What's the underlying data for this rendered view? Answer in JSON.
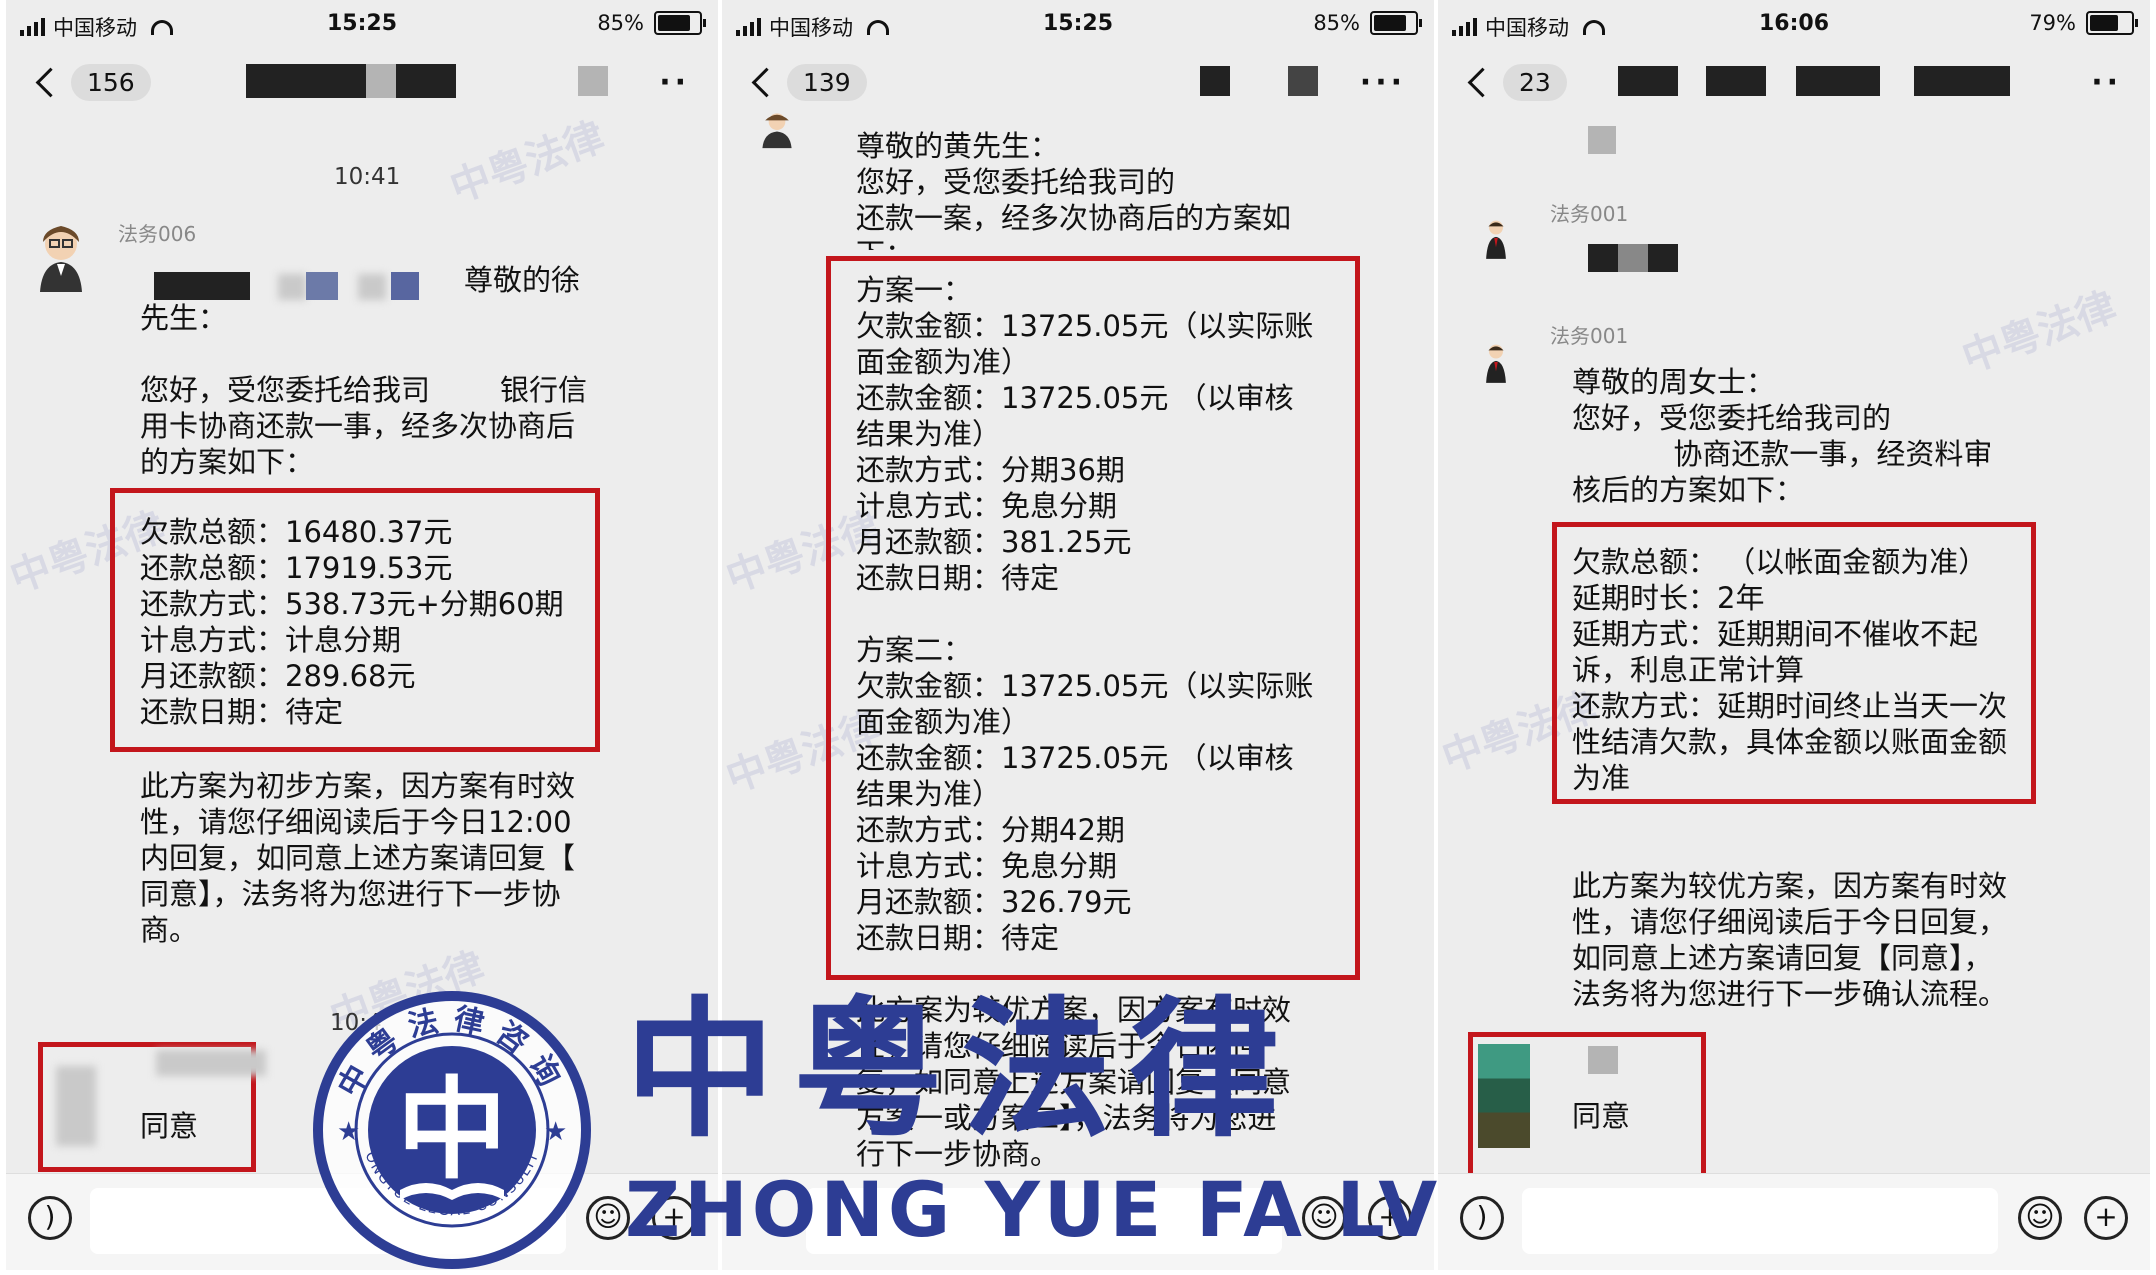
{
  "panels": [
    {
      "status": {
        "carrier": "中国移动",
        "time": "15:25",
        "battery": "85%"
      },
      "back_count": "156",
      "chat_time_1": "10:41",
      "sender": "法务006",
      "greeting_tail": "尊敬的徐",
      "lines_top": [
        "先生：",
        "",
        "您好，受您委托给我司",
        "用卡协商还款一事，经多次协商后",
        "的方案如下："
      ],
      "bank_fragment": "银行信",
      "box_lines": [
        "欠款总额：16480.37元",
        "还款总额：17919.53元",
        "还款方式：538.73元+分期60期",
        "计息方式：计息分期",
        "月还款额：289.68元",
        "还款日期：待定"
      ],
      "lines_bottom": [
        "此方案为初步方案，因方案有时效",
        "性，请您仔细阅读后于今日12:00",
        "内回复，如同意上述方案请回复【",
        "同意】，法务将为您进行下一步协",
        "商。"
      ],
      "chat_time_2": "10:4",
      "reply": "同意"
    },
    {
      "status": {
        "carrier": "中国移动",
        "time": "15:25",
        "battery": "85%"
      },
      "back_count": "139",
      "lines_top": [
        "尊敬的黄先生：",
        "您好，受您委托给我司的",
        "还款一案，经多次协商后的方案如",
        "下："
      ],
      "box_lines": [
        "方案一：",
        "欠款金额：13725.05元（以实际账",
        "面金额为准）",
        "还款金额：13725.05元 （以审核",
        "结果为准）",
        "还款方式：分期36期",
        "计息方式：免息分期",
        "月还款额：381.25元",
        "还款日期：待定",
        "",
        "方案二：",
        "欠款金额：13725.05元（以实际账",
        "面金额为准）",
        "还款金额：13725.05元 （以审核",
        "结果为准）",
        "还款方式：分期42期",
        "计息方式：免息分期",
        "月还款额：326.79元",
        "还款日期：待定"
      ],
      "lines_bottom": [
        "此方案为较优方案，因方案有时效",
        "性，请您仔细阅读后于今日内回",
        "复，如同意上述方案请回复【同意",
        "方案一或方案二】，法务将为您进",
        "行下一步协商。"
      ]
    },
    {
      "status": {
        "carrier": "中国移动",
        "time": "16:06",
        "battery": "79%"
      },
      "back_count": "23",
      "sender_1": "法务001",
      "sender_2": "法务001",
      "lines_top": [
        "尊敬的周女士：",
        "您好，受您委托给我司的",
        "           协商还款一事，经资料审",
        "核后的方案如下："
      ],
      "box_lines": [
        "欠款总额： （以帐面金额为准）",
        "延期时长：2年",
        "延期方式：延期期间不催收不起",
        "诉，利息正常计算",
        "还款方式：延期时间终止当天一次",
        "性结清欠款，具体金额以账面金额",
        "为准"
      ],
      "lines_bottom": [
        "此方案为较优方案，因方案有时效",
        "性，请您仔细阅读后于今日回复，",
        "如同意上述方案请回复【同意】，",
        "法务将为您进行下一步确认流程。"
      ],
      "reply": "同意"
    }
  ],
  "watermark": {
    "seal_top": "中粤法律咨询",
    "seal_bottom": "ZHONGYUE LEGAL CONSULTING",
    "seal_center": "中",
    "title": "中粤法律",
    "subtitle": "ZHONG YUE FA LV",
    "bg_text": "中粤法律"
  },
  "colors": {
    "accent_red": "#c3161c",
    "logo_blue": "#2d3d94",
    "chat_bg": "#ededed"
  },
  "icons": [
    "signal-icon",
    "wifi-icon",
    "battery-icon",
    "back-arrow-icon",
    "more-icon",
    "voice-icon",
    "emoji-icon",
    "plus-icon"
  ]
}
